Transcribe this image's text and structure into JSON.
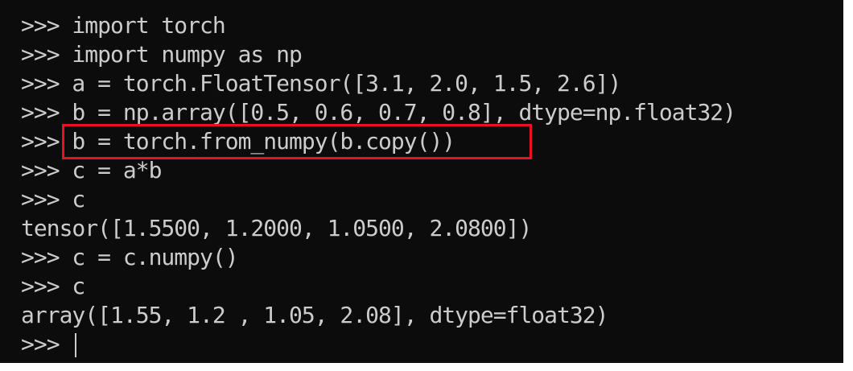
{
  "terminal": {
    "lines": [
      ">>> import torch",
      ">>> import numpy as np",
      ">>> a = torch.FloatTensor([3.1, 2.0, 1.5, 2.6])",
      ">>> b = np.array([0.5, 0.6, 0.7, 0.8], dtype=np.float32)",
      ">>> b = torch.from_numpy(b.copy())",
      ">>> c = a*b",
      ">>> c",
      "tensor([1.5500, 1.2000, 1.0500, 2.0800])",
      ">>> c = c.numpy()",
      ">>> c",
      "array([1.55, 1.2 , 1.05, 2.08], dtype=float32)",
      ">>> "
    ]
  },
  "colors": {
    "background": "#0c0c0c",
    "foreground": "#cccccc",
    "highlight_border": "#e81123"
  }
}
